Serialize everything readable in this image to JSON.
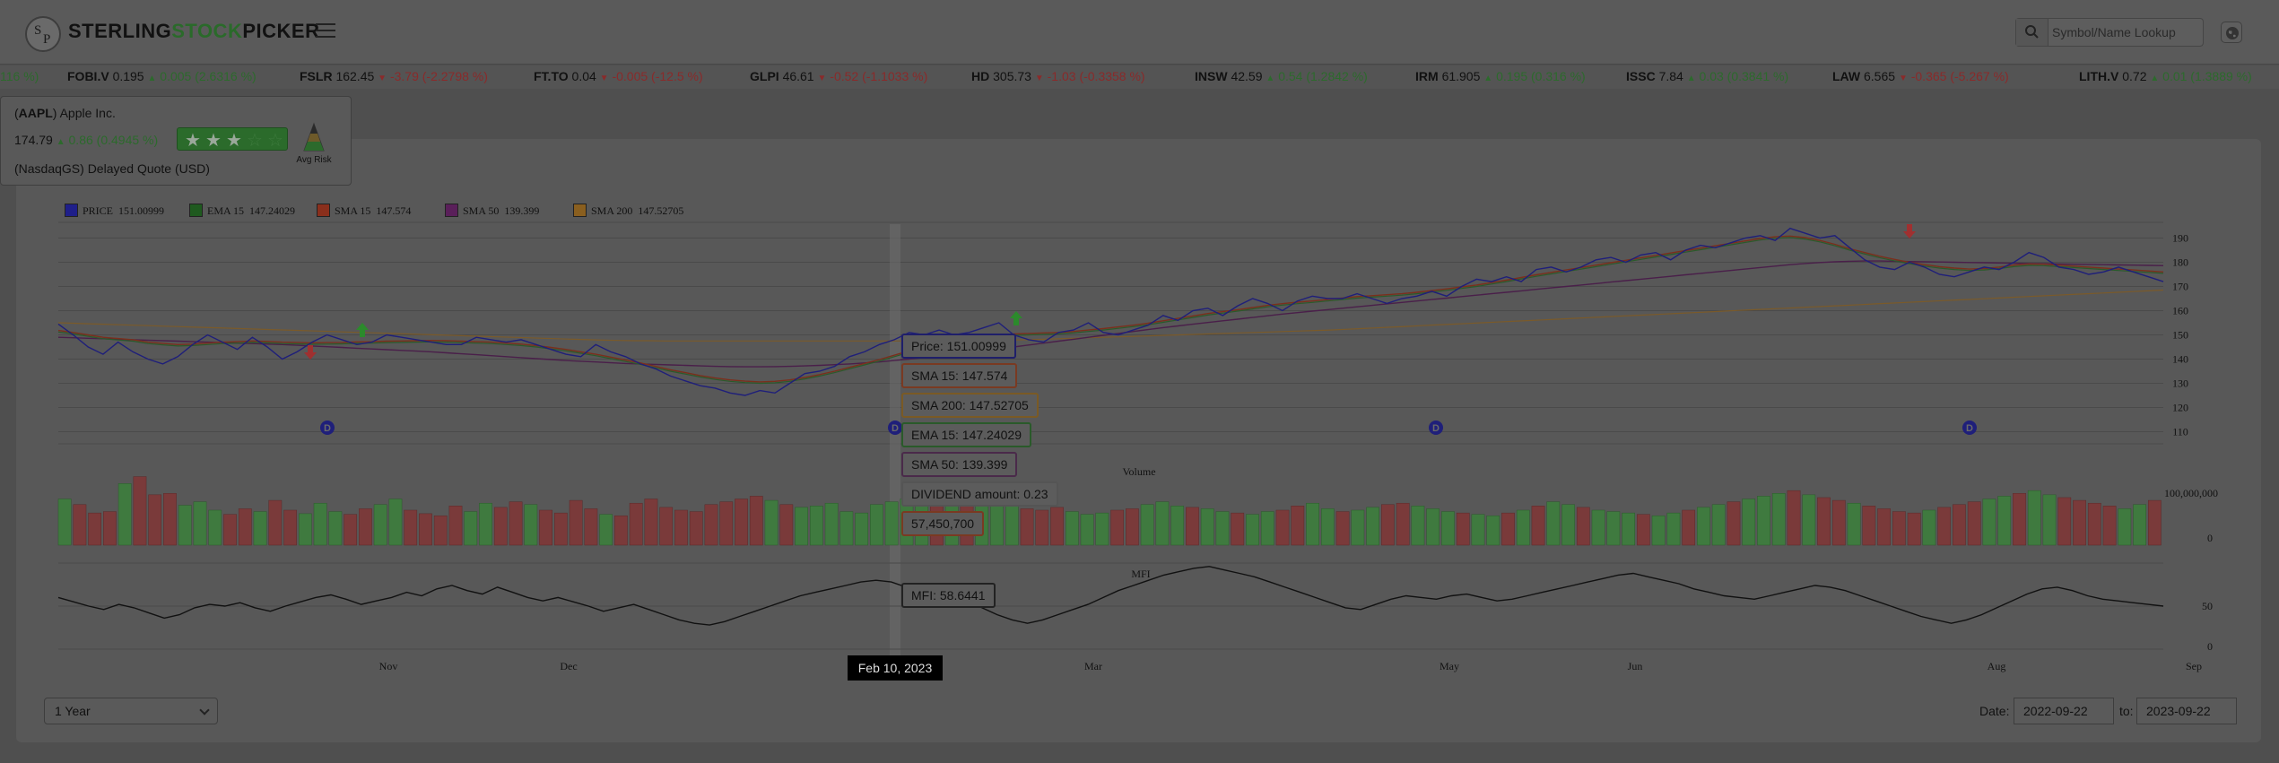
{
  "header": {
    "logo_letters": [
      "S",
      "P"
    ],
    "brand_part1": "STERLING",
    "brand_part2": "STOCK",
    "brand_part3": "PICKER",
    "search_placeholder": "Symbol/Name Lookup"
  },
  "ticker": [
    {
      "sym": "",
      "price": "",
      "change": "116 %)",
      "dir": "up"
    },
    {
      "sym": "FOBI.V",
      "price": "0.195",
      "change": "0.005 (2.6316 %)",
      "dir": "up"
    },
    {
      "sym": "FSLR",
      "price": "162.45",
      "change": "-3.79 (-2.2798 %)",
      "dir": "dn"
    },
    {
      "sym": "FT.TO",
      "price": "0.04",
      "change": "-0.005 (-12.5 %)",
      "dir": "dn"
    },
    {
      "sym": "GLPI",
      "price": "46.61",
      "change": "-0.52 (-1.1033 %)",
      "dir": "dn"
    },
    {
      "sym": "HD",
      "price": "305.73",
      "change": "-1.03 (-0.3358 %)",
      "dir": "dn"
    },
    {
      "sym": "INSW",
      "price": "42.59",
      "change": "0.54 (1.2842 %)",
      "dir": "up"
    },
    {
      "sym": "IRM",
      "price": "61.905",
      "change": "0.195 (0.316 %)",
      "dir": "up"
    },
    {
      "sym": "ISSC",
      "price": "7.84",
      "change": "0.03 (0.3841 %)",
      "dir": "up"
    },
    {
      "sym": "LAW",
      "price": "6.565",
      "change": "-0.365 (-5.267 %)",
      "dir": "dn"
    },
    {
      "sym": "LITH.V",
      "price": "0.72",
      "change": "0.01 (1.3889 %)",
      "dir": "up"
    }
  ],
  "quote": {
    "symbol": "AAPL",
    "name": "Apple Inc.",
    "price": "174.79",
    "change": "0.86",
    "change_pct": "(0.4945 %)",
    "exchange_note": "(NasdaqGS) Delayed Quote (USD)",
    "rating_stars": 3,
    "rating_max": 5,
    "risk_label": "Avg Risk"
  },
  "legend": [
    {
      "name": "PRICE",
      "value": "151.00999",
      "color": "#1f1f8a"
    },
    {
      "name": "EMA 15",
      "value": "147.24029",
      "color": "#1f5a1f"
    },
    {
      "name": "SMA 15",
      "value": "147.574",
      "color": "#8a2f1c"
    },
    {
      "name": "SMA 50",
      "value": "139.399",
      "color": "#5a1f5a"
    },
    {
      "name": "SMA 200",
      "value": "147.52705",
      "color": "#8a5f1f"
    }
  ],
  "tooltips": {
    "price": "Price: 151.00999",
    "sma15": "SMA 15: 147.574",
    "sma200": "SMA 200: 147.52705",
    "ema15": "EMA 15: 147.24029",
    "sma50": "SMA 50: 139.399",
    "dividend": "DIVIDEND amount: 0.23",
    "volume": "57,450,700",
    "mfi": "MFI: 58.6441",
    "date": "Feb 10, 2023"
  },
  "chart_labels": {
    "volume_title": "Volume",
    "volume_axis_top": "100,000,000",
    "volume_axis_zero": "0",
    "mfi_title": "MFI",
    "mfi_ticks": [
      "50",
      "0"
    ],
    "dividend_marker": "D"
  },
  "chart_data": {
    "type": "line",
    "x_ticks": [
      "Nov",
      "Dec",
      "Mar",
      "May",
      "Jun",
      "Aug",
      "Sep"
    ],
    "y_ticks": [
      190,
      180,
      170,
      160,
      150,
      140,
      130,
      120,
      110
    ],
    "ylim": [
      105,
      195
    ],
    "price": [
      154.5,
      150,
      145,
      142,
      147,
      143,
      140,
      138,
      141,
      146,
      150,
      147,
      144,
      149,
      145,
      140,
      143,
      147,
      150,
      148,
      146,
      147,
      150,
      149,
      148,
      147,
      146,
      146,
      149,
      148,
      147,
      148,
      146,
      144,
      142,
      141,
      146,
      143,
      141,
      138,
      136,
      133,
      131,
      129,
      128,
      126,
      125,
      127,
      126,
      130,
      134,
      135,
      137,
      141,
      143,
      146,
      148,
      151,
      150,
      152,
      150,
      151,
      153,
      155,
      150,
      148,
      147,
      151,
      152,
      155,
      151,
      150,
      152,
      154,
      158,
      156,
      160,
      161,
      158,
      162,
      165,
      163,
      160,
      164,
      166,
      165,
      165,
      167,
      165,
      163,
      165,
      166,
      168,
      166,
      170,
      173,
      172,
      174,
      172,
      177,
      178,
      176,
      178,
      181,
      182,
      180,
      183,
      184,
      181,
      185,
      187,
      186,
      188,
      190,
      191,
      189,
      194,
      192,
      190,
      191,
      186,
      181,
      178,
      177,
      180,
      178,
      175,
      174,
      176,
      178,
      177,
      180,
      184,
      182,
      178,
      177,
      175,
      176,
      178,
      176,
      174,
      172
    ],
    "sma15": [
      151.8,
      151,
      150,
      149,
      148.5,
      148,
      147,
      146.5,
      146,
      146.2,
      146.6,
      147,
      147.2,
      147.5,
      147.3,
      147,
      146.9,
      146.7,
      146.8,
      146.9,
      147.1,
      147.2,
      147.4,
      147.5,
      147.6,
      147.7,
      147.6,
      147.4,
      147.2,
      147,
      146.6,
      146.2,
      145.6,
      144.8,
      144,
      143,
      142,
      140.8,
      139.6,
      138.4,
      137,
      135.6,
      134.4,
      133.2,
      132.2,
      131.4,
      130.9,
      130.6,
      130.8,
      131.4,
      132.4,
      133.6,
      135,
      136.6,
      138.2,
      139.8,
      141.6,
      143.4,
      145,
      146.6,
      147.6,
      148.6,
      149.4,
      150,
      150.4,
      150.6,
      150.8,
      151,
      151.4,
      152,
      152.6,
      153.3,
      154,
      154.8,
      155.8,
      156.8,
      157.8,
      158.8,
      159.6,
      160.4,
      161.3,
      162.2,
      162.9,
      163.5,
      164,
      164.6,
      165.2,
      165.8,
      166.2,
      166.6,
      167,
      167.6,
      168.3,
      169,
      169.8,
      170.6,
      171.6,
      172.6,
      173.7,
      174.8,
      175.8,
      176.8,
      177.8,
      178.8,
      179.8,
      180.8,
      181.8,
      182.8,
      183.8,
      184.8,
      185.8,
      186.8,
      187.8,
      188.8,
      189.8,
      190.5,
      190.8,
      190.2,
      189,
      187.4,
      185.6,
      184,
      182.5,
      181.2,
      180,
      179,
      178.2,
      177.6,
      177.2,
      177.4,
      178,
      178.8,
      179.3,
      179.2,
      178.8,
      178.4,
      178,
      177.6,
      177.2,
      176.8,
      176.4,
      176
    ],
    "sma50": [
      149,
      148.8,
      148.6,
      148.4,
      148.2,
      148,
      147.8,
      147.6,
      147.4,
      147.2,
      147,
      146.8,
      146.6,
      146.4,
      146.2,
      146,
      145.7,
      145.4,
      145.1,
      144.8,
      144.5,
      144.2,
      143.9,
      143.6,
      143.3,
      143,
      142.6,
      142.2,
      141.8,
      141.4,
      141,
      140.6,
      140.2,
      139.8,
      139.4,
      139.1,
      138.8,
      138.5,
      138.2,
      138,
      137.8,
      137.6,
      137.4,
      137.2,
      137,
      136.9,
      136.8,
      136.8,
      136.9,
      137,
      137.2,
      137.4,
      137.7,
      138,
      138.4,
      138.8,
      139.4,
      140,
      140.6,
      141.3,
      142,
      142.7,
      143.4,
      144.2,
      145,
      145.8,
      146.6,
      147.4,
      148.2,
      149,
      149.8,
      150.6,
      151.4,
      152.2,
      153,
      153.7,
      154.4,
      155.1,
      155.8,
      156.5,
      157.2,
      157.9,
      158.6,
      159.2,
      159.8,
      160.4,
      161,
      161.6,
      162.2,
      162.8,
      163.4,
      164,
      164.6,
      165.2,
      165.8,
      166.4,
      167,
      167.6,
      168.2,
      168.8,
      169.4,
      170,
      170.6,
      171.2,
      171.8,
      172.4,
      173,
      173.6,
      174.2,
      174.8,
      175.4,
      176,
      176.6,
      177.2,
      177.8,
      178.4,
      179,
      179.5,
      179.9,
      180.2,
      180.4,
      180.5,
      180.5,
      180.4,
      180.3,
      180.2,
      180.1,
      180,
      179.9,
      179.8,
      179.7,
      179.6,
      179.5,
      179.4,
      179.3,
      179.2,
      179.1,
      179,
      178.9,
      178.8,
      178.7,
      178.6
    ],
    "sma200": [
      155,
      154.8,
      154.6,
      154.4,
      154.2,
      154,
      153.8,
      153.6,
      153.4,
      153.2,
      153,
      152.8,
      152.6,
      152.4,
      152.2,
      152,
      151.8,
      151.6,
      151.4,
      151.2,
      151,
      150.8,
      150.6,
      150.4,
      150.2,
      150,
      149.8,
      149.6,
      149.4,
      149.2,
      149,
      148.8,
      148.6,
      148.4,
      148.2,
      148,
      147.8,
      147.7,
      147.6,
      147.6,
      147.5,
      147.5,
      147.5,
      147.5,
      147.5,
      147.5,
      147.5,
      147.5,
      147.5,
      147.5,
      147.5,
      147.5,
      147.5,
      147.5,
      147.5,
      147.5,
      147.5,
      147.5,
      147.5,
      147.5,
      147.6,
      147.7,
      147.8,
      147.9,
      148,
      148.2,
      148.4,
      148.6,
      148.8,
      149,
      149.2,
      149.4,
      149.6,
      149.8,
      150,
      150.2,
      150.4,
      150.6,
      150.8,
      151,
      151.2,
      151.4,
      151.6,
      151.8,
      152,
      152.3,
      152.6,
      152.9,
      153.2,
      153.5,
      153.8,
      154.1,
      154.4,
      154.7,
      155,
      155.3,
      155.6,
      155.9,
      156.2,
      156.5,
      156.8,
      157.1,
      157.4,
      157.7,
      158,
      158.3,
      158.6,
      158.9,
      159.2,
      159.5,
      159.8,
      160.1,
      160.4,
      160.7,
      161,
      161.3,
      161.6,
      161.9,
      162.2,
      162.5,
      162.8,
      163.1,
      163.4,
      163.7,
      164,
      164.3,
      164.6,
      164.9,
      165.2,
      165.5,
      165.8,
      166.1,
      166.4,
      166.7,
      167,
      167.3,
      167.6,
      167.9,
      168.2,
      168.5
    ],
    "mfi": [
      60,
      55,
      50,
      46,
      52,
      48,
      42,
      36,
      40,
      48,
      52,
      50,
      54,
      48,
      44,
      50,
      55,
      60,
      63,
      58,
      52,
      56,
      60,
      66,
      62,
      70,
      74,
      68,
      64,
      72,
      66,
      60,
      56,
      60,
      55,
      50,
      44,
      48,
      52,
      46,
      40,
      34,
      30,
      28,
      32,
      38,
      44,
      50,
      56,
      62,
      66,
      70,
      74,
      78,
      80,
      78,
      72,
      76,
      70,
      60,
      56,
      48,
      40,
      34,
      30,
      34,
      40,
      46,
      52,
      60,
      68,
      74,
      80,
      86,
      90,
      94,
      96,
      92,
      88,
      84,
      78,
      72,
      66,
      60,
      54,
      48,
      46,
      52,
      58,
      62,
      60,
      58,
      62,
      64,
      60,
      56,
      58,
      62,
      66,
      70,
      74,
      78,
      82,
      86,
      88,
      84,
      80,
      76,
      70,
      66,
      62,
      60,
      58,
      62,
      66,
      70,
      74,
      72,
      68,
      62,
      56,
      50,
      44,
      38,
      34,
      30,
      34,
      40,
      48,
      56,
      64,
      70,
      72,
      68,
      62,
      58,
      56,
      54,
      52,
      50
    ],
    "volume": [
      66,
      58,
      46,
      48,
      88,
      98,
      72,
      74,
      57,
      62,
      50,
      44,
      52,
      48,
      64,
      50,
      45,
      60,
      48,
      44,
      52,
      58,
      66,
      50,
      45,
      42,
      56,
      48,
      60,
      54,
      62,
      58,
      50,
      46,
      64,
      52,
      44,
      42,
      60,
      66,
      54,
      50,
      48,
      58,
      62,
      66,
      70,
      64,
      58,
      54,
      56,
      60,
      48,
      46,
      58,
      62,
      66,
      72,
      86,
      78,
      70,
      64,
      58,
      56,
      52,
      50,
      54,
      48,
      44,
      46,
      50,
      52,
      58,
      62,
      56,
      54,
      52,
      48,
      46,
      44,
      48,
      50,
      56,
      60,
      52,
      48,
      50,
      54,
      58,
      60,
      56,
      52,
      48,
      46,
      44,
      42,
      46,
      50,
      56,
      62,
      58,
      54,
      50,
      48,
      46,
      44,
      42,
      46,
      50,
      54,
      58,
      62,
      66,
      70,
      74,
      78,
      72,
      68,
      64,
      60,
      56,
      52,
      48,
      46,
      50,
      54,
      58,
      62,
      66,
      70,
      74,
      78,
      72,
      68,
      64,
      60,
      56,
      52,
      58,
      64
    ]
  },
  "controls": {
    "range_value": "1 Year",
    "date_label": "Date:",
    "date_from": "2022-09-22",
    "to_label": "to:",
    "date_to": "2023-09-22"
  },
  "colors": {
    "up": "#2c6a2c",
    "down": "#8a2a2a",
    "accent_green": "#2a6a2a"
  }
}
